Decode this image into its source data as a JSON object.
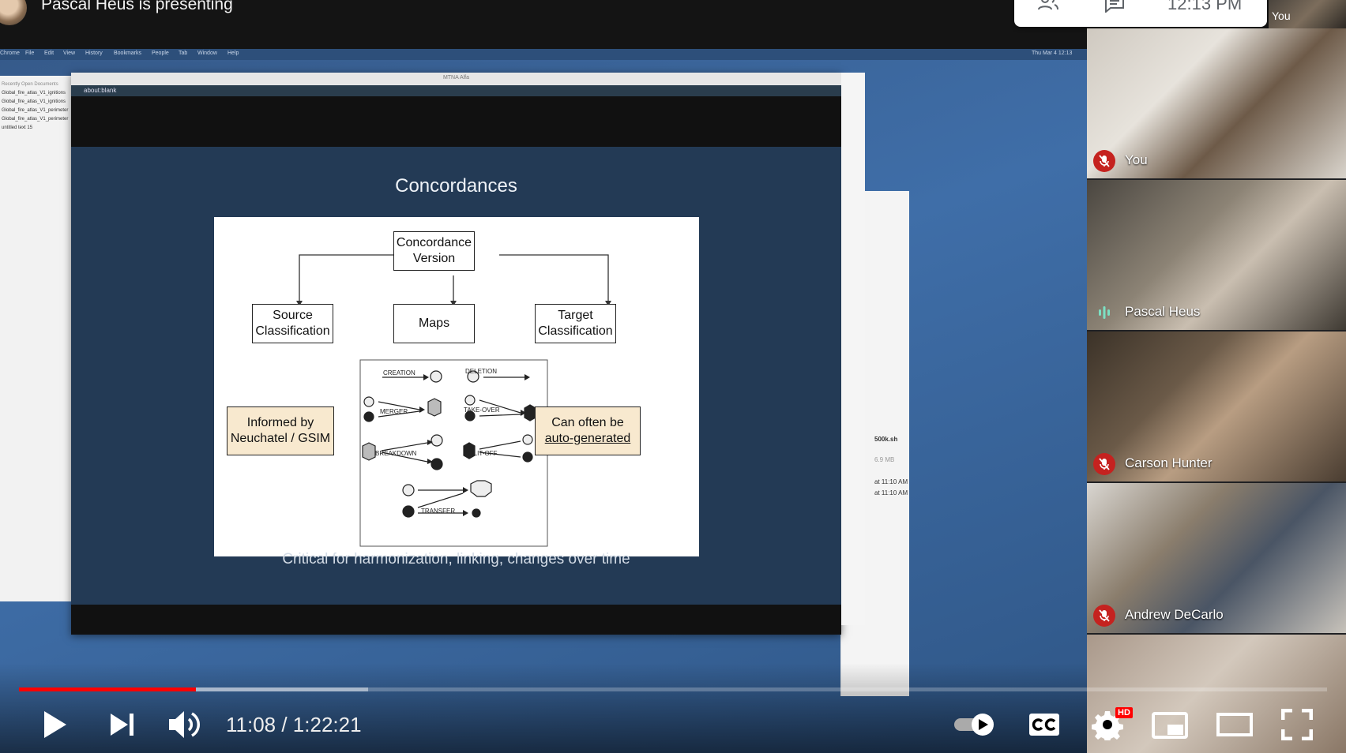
{
  "meet": {
    "presenter_text": "Pascal Heus is presenting",
    "time": "12:13 PM",
    "self_label": "You"
  },
  "shared_screen": {
    "browser_title": "MTNA Alfa",
    "address": "about:blank",
    "left_doc_lines": [
      "Recently Open Documents",
      "Global_fire_atlas_V1_ignitions",
      "Global_fire_atlas_V1_ignitions",
      "Global_fire_atlas_V1_perimeter",
      "Global_fire_atlas_V1_perimeter",
      "untitled text 15"
    ],
    "right_window_lines": [
      "500k.sh",
      "6.9 MB",
      "at 11:10 AM",
      "at 11:10 AM"
    ],
    "menubar_items": [
      "Chrome",
      "File",
      "Edit",
      "View",
      "History",
      "Bookmarks",
      "People",
      "Tab",
      "Window",
      "Help"
    ],
    "menubar_clock": "Thu Mar 4  12:13"
  },
  "slide": {
    "title": "Concordances",
    "subtitle": "Critical for harmonization, linking, changes over time",
    "diagram": {
      "top_box": "Concordance Version",
      "left_box": "Source Classification",
      "center_box": "Maps",
      "right_box": "Target Classification",
      "left_note": "Informed by Neuchatel / GSIM",
      "right_note_1": "Can often be",
      "right_note_2": "auto-generated",
      "labels": [
        "CREATION",
        "DELETION",
        "MERGER",
        "TAKE-OVER",
        "BREAKDOWN",
        "SPLIT-OFF",
        "TRANSFER"
      ]
    }
  },
  "participants": [
    {
      "name": "You",
      "muted": true
    },
    {
      "name": "Pascal Heus",
      "muted": false,
      "speaking": true
    },
    {
      "name": "Carson Hunter",
      "muted": true
    },
    {
      "name": "Andrew DeCarlo",
      "muted": true
    },
    {
      "name": "",
      "muted": false
    }
  ],
  "player": {
    "current_time": "11:08",
    "duration": "1:22:21",
    "time_display": "11:08 / 1:22:21",
    "played_fraction": 0.135,
    "buffered_fraction": 0.132,
    "hd_badge": "HD",
    "colors": {
      "progress": "#ff0000",
      "hd": "#ff0000"
    }
  }
}
